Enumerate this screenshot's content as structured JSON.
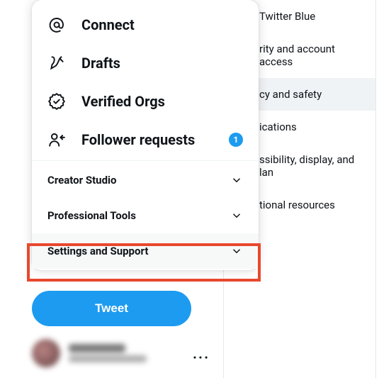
{
  "settings": {
    "items": [
      {
        "label": "Twitter Blue",
        "selected": false
      },
      {
        "label": "rity and account access",
        "selected": false
      },
      {
        "label": "cy and safety",
        "selected": true
      },
      {
        "label": "ications",
        "selected": false
      },
      {
        "label": "ssibility, display, and lan",
        "selected": false
      },
      {
        "label": "tional resources",
        "selected": false
      }
    ]
  },
  "menu": {
    "items": [
      {
        "icon": "at-icon",
        "label": "Connect",
        "badge": null
      },
      {
        "icon": "drafts-icon",
        "label": "Drafts",
        "badge": null
      },
      {
        "icon": "verified-icon",
        "label": "Verified Orgs",
        "badge": null
      },
      {
        "icon": "follower-requests-icon",
        "label": "Follower requests",
        "badge": "1"
      }
    ],
    "expand": [
      {
        "label": "Creator Studio",
        "hovered": false
      },
      {
        "label": "Professional Tools",
        "hovered": false
      },
      {
        "label": "Settings and Support",
        "hovered": true
      }
    ]
  },
  "tweet_button_label": "Tweet",
  "colors": {
    "accent": "#1d9bf0",
    "highlight": "#e8482e"
  }
}
